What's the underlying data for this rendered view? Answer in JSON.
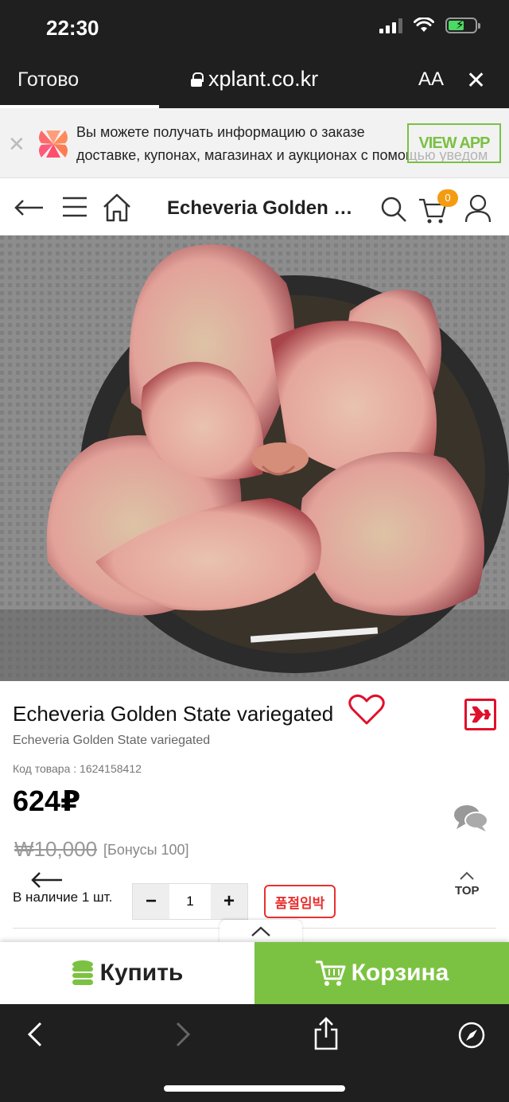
{
  "status_bar": {
    "time": "22:30"
  },
  "browser": {
    "done_label": "Готово",
    "url": "xplant.co.kr",
    "text_size_label": "AA"
  },
  "app_banner": {
    "line1": "Вы можете получать информацию о заказе",
    "line2": "доставке, купонах, магазинах и аукционах с помощью уведом",
    "button": "VIEW APP",
    "accent": "#7bc043"
  },
  "header": {
    "title": "Echeveria Golden …",
    "cart_count": "0"
  },
  "product": {
    "title": "Echeveria Golden State variegated",
    "subtitle": "Echeveria Golden State variegated",
    "code_label": "Код товара : 1624158412",
    "price": "624₽",
    "old_price": "₩10,000",
    "bonus": "[Бонусы 100]",
    "stock": "В наличие 1 шт.",
    "quantity": "1",
    "minus": "−",
    "plus": "+",
    "soldout_badge": "품절임박",
    "top_label": "TOP"
  },
  "actions": {
    "buy": "Купить",
    "cart": "Корзина",
    "cart_color": "#7cc242"
  },
  "colors": {
    "chrome": "#1f1f1f",
    "heart": "#e0102a",
    "badge": "#f39c12"
  }
}
